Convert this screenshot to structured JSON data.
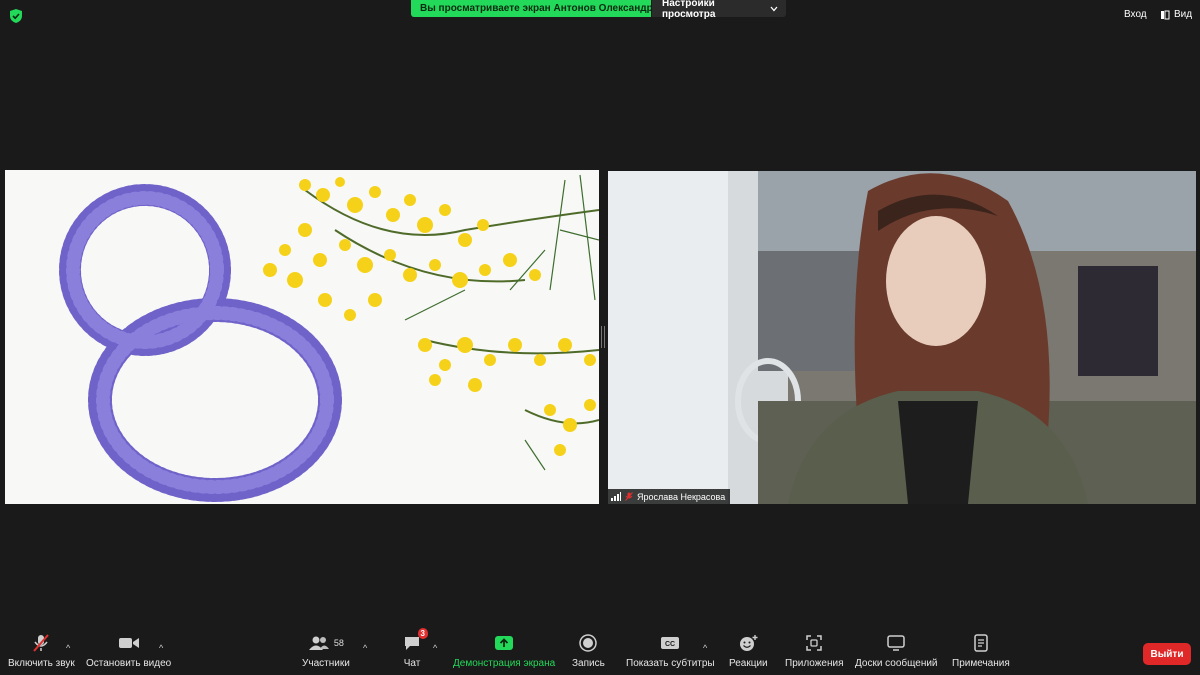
{
  "top": {
    "share_banner": "Вы просматриваете экран Антонов Олександр",
    "view_options": "Настройки просмотра",
    "sign_in": "Вход",
    "view": "Вид"
  },
  "participant": {
    "name": "Ярослава Некрасова"
  },
  "toolbar": {
    "unmute": "Включить звук",
    "stop_video": "Остановить видео",
    "participants": "Участники",
    "participants_count": "58",
    "chat": "Чат",
    "chat_badge": "3",
    "share_screen": "Демонстрация экрана",
    "record": "Запись",
    "captions": "Показать субтитры",
    "reactions": "Реакции",
    "apps": "Приложения",
    "whiteboards": "Доски сообщений",
    "notes": "Примечания",
    "leave": "Выйти"
  },
  "colors": {
    "accent_green": "#23d959",
    "leave_red": "#e02828",
    "badge_red": "#e02f2f",
    "background": "#1a1a1a"
  }
}
